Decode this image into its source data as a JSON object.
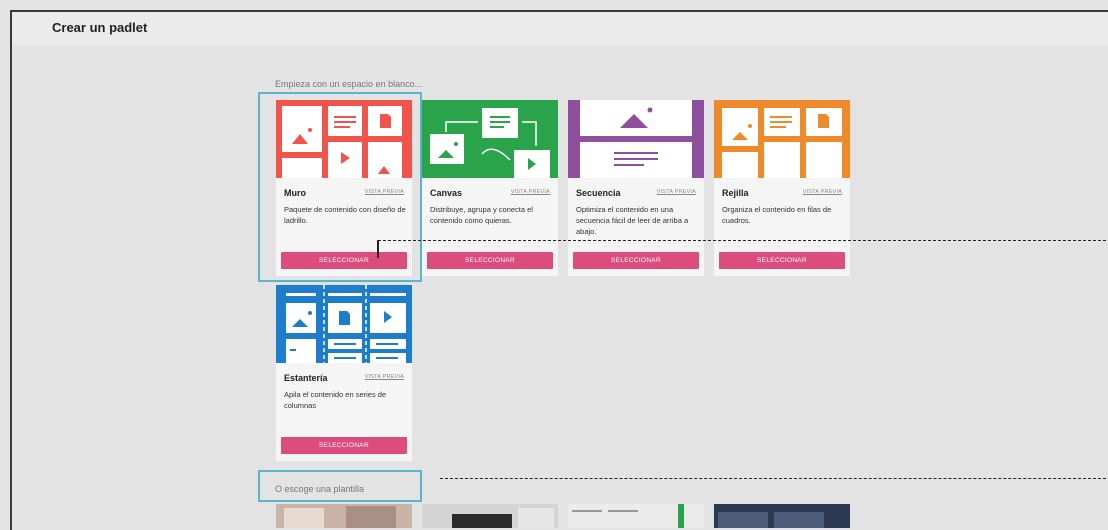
{
  "header": {
    "title": "Crear un padlet"
  },
  "blank_section": {
    "label": "Empieza con un espacio en blanco..."
  },
  "template_section": {
    "label": "O escoge una plantilla"
  },
  "cards": [
    {
      "title": "Muro",
      "preview": "VISTA PREVIA",
      "description": "Paquete de contenido con diseño de ladrillo.",
      "button": "SELECCIONAR",
      "color": "#f0544b"
    },
    {
      "title": "Canvas",
      "preview": "VISTA PREVIA",
      "description": "Distribuye, agrupa y conecta el contenido como quieras.",
      "button": "SELECCIONAR",
      "color": "#2aa44a"
    },
    {
      "title": "Secuencia",
      "preview": "VISTA PREVIA",
      "description": "Optimiza el contenido en una secuencia fácil de leer de arriba a abajo.",
      "button": "SELECCIONAR",
      "color": "#8e4f9c"
    },
    {
      "title": "Rejilla",
      "preview": "VISTA PREVIA",
      "description": "Organiza el contenido en filas de cuadros.",
      "button": "SELECCIONAR",
      "color": "#ee8a2a"
    },
    {
      "title": "Estantería",
      "preview": "VISTA PREVIA",
      "description": "Apila el contenido en series de columnas",
      "button": "SELECCIONAR",
      "color": "#1d7ccc"
    }
  ]
}
